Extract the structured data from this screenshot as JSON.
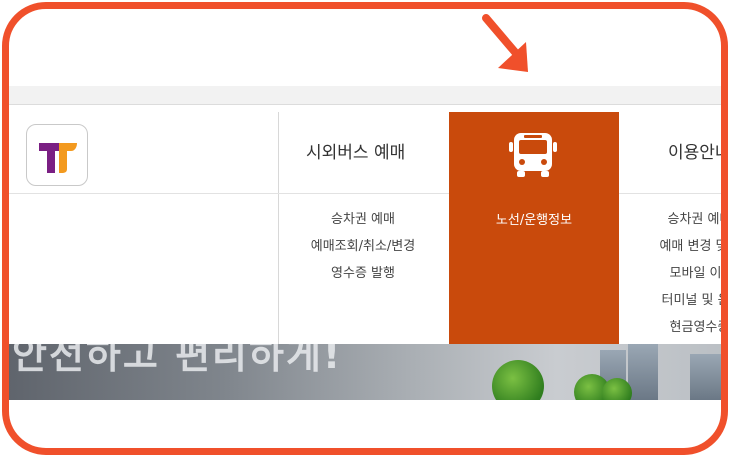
{
  "colors": {
    "frame": "#f0502b",
    "highlight": "#c94a0c",
    "arrow": "#f0502b"
  },
  "nav": {
    "logo_icon": "t-money-logo-icon",
    "menus": [
      {
        "title": "시외버스 예매",
        "items": [
          "승차권 예매",
          "예매조회/취소/변경",
          "영수증 발행"
        ]
      },
      {
        "icon": "bus-icon",
        "items": [
          "노선/운행정보"
        ]
      },
      {
        "title": "이용안내",
        "items": [
          "승차권 예매 안",
          "예매 변경 및 취소",
          "모바일 이용안",
          "터미널 및 운수사",
          "현금영수증 안"
        ]
      }
    ]
  },
  "banner": {
    "text": "안전하고 편리하게!"
  },
  "annotation": {
    "arrow_icon": "pointer-arrow-icon"
  }
}
